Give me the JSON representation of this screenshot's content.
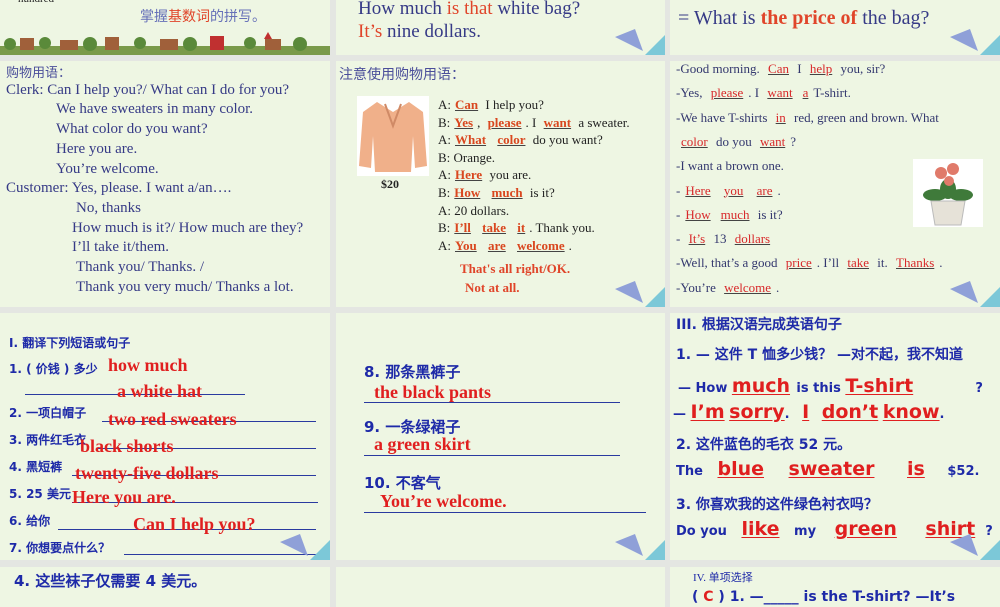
{
  "top": {
    "c1_hundred": "hundred",
    "c1_tip_a": "掌握",
    "c1_tip_b": "基数词",
    "c1_tip_c": "的拼写。",
    "c2_l1_a": "How much ",
    "c2_l1_b": "is that",
    "c2_l1_c": " white bag?",
    "c2_l2_a": "It’s",
    "c2_l2_b": " nine dollars.",
    "c3_a": "= What is ",
    "c3_b": "the price of",
    "c3_c": " the bag?"
  },
  "p1": {
    "lines": [
      "购物用语：",
      "Clerk: Can I help you?/ What can I do for you?",
      "We have sweaters in many color.",
      "What color do you want?",
      "Here you are.",
      "You’re welcome.",
      "Customer: Yes, please. I want a/an….",
      "No, thanks",
      "How much is it?/ How much are they?",
      "I’ll take it/them.",
      "Thank you/ Thanks. /",
      "Thank you very much/ Thanks a lot."
    ]
  },
  "p2": {
    "title": "注意使用购物用语：",
    "price": "$20",
    "lines": [
      [
        {
          "t": "A:"
        },
        {
          "b": "Can"
        },
        {
          "t": " I help you?"
        }
      ],
      [
        {
          "t": "B:"
        },
        {
          "b": "Yes"
        },
        {
          "t": ", "
        },
        {
          "b": "please"
        },
        {
          "t": ". I "
        },
        {
          "b": "want"
        },
        {
          "t": " a sweater."
        }
      ],
      [
        {
          "t": "A:"
        },
        {
          "b": "What"
        },
        {
          "t": " "
        },
        {
          "b": "color"
        },
        {
          "t": " do you want?"
        }
      ],
      [
        {
          "t": "B: Orange."
        }
      ],
      [
        {
          "t": "A:"
        },
        {
          "b": "Here"
        },
        {
          "t": " you are."
        }
      ],
      [
        {
          "t": "B:"
        },
        {
          "b": "How"
        },
        {
          "t": " "
        },
        {
          "b": "much"
        },
        {
          "t": " is it?"
        }
      ],
      [
        {
          "t": "A: 20 dollars."
        }
      ],
      [
        {
          "t": "B:"
        },
        {
          "b": "I’ll"
        },
        {
          "t": " "
        },
        {
          "b": "take"
        },
        {
          "t": " "
        },
        {
          "b": "it"
        },
        {
          "t": ". Thank you."
        }
      ],
      [
        {
          "t": "A:"
        },
        {
          "b": "You"
        },
        {
          "t": " "
        },
        {
          "b": "are"
        },
        {
          "t": " "
        },
        {
          "b": "welcome"
        },
        {
          "t": "."
        }
      ]
    ],
    "alt1": "That's all right/OK.",
    "alt2": "Not at all."
  },
  "p3": {
    "lines": [
      [
        {
          "t": "-Good morning. "
        },
        {
          "b": "Can"
        },
        {
          "t": " I "
        },
        {
          "b": "help"
        },
        {
          "t": " you, sir?"
        }
      ],
      [
        {
          "t": "-Yes, "
        },
        {
          "b": "please"
        },
        {
          "t": ". I "
        },
        {
          "b": "want"
        },
        {
          "b": "a"
        },
        {
          "t": "T-shirt."
        }
      ],
      [
        {
          "t": "-We have T-shirts "
        },
        {
          "b": "in"
        },
        {
          "t": " red, green and brown. What"
        }
      ],
      [
        {
          "b": "color"
        },
        {
          "t": " do you "
        },
        {
          "b": "want"
        },
        {
          "t": "?"
        }
      ],
      [
        {
          "t": "-I want a brown one."
        }
      ],
      [
        {
          "t": "-"
        },
        {
          "b": "Here"
        },
        {
          "t": " "
        },
        {
          "b": "you"
        },
        {
          "t": " "
        },
        {
          "b": "are"
        },
        {
          "t": "."
        }
      ],
      [
        {
          "t": "-"
        },
        {
          "b": "How"
        },
        {
          "b": "much"
        },
        {
          "t": " is it?"
        }
      ],
      [
        {
          "t": "- "
        },
        {
          "b": "It’s"
        },
        {
          "t": " 13 "
        },
        {
          "b": "dollars"
        }
      ],
      [
        {
          "t": "-Well, that’s a good "
        },
        {
          "b": "price"
        },
        {
          "t": ". I’ll "
        },
        {
          "b": "take"
        },
        {
          "t": " it. "
        },
        {
          "b": "Thanks"
        },
        {
          "t": "."
        }
      ],
      [
        {
          "t": "-You’re "
        },
        {
          "b": "welcome"
        },
        {
          "t": "."
        }
      ]
    ]
  },
  "p4": {
    "title": "I. 翻译下列短语或句子",
    "q": [
      "1. ( 价钱 ) 多少",
      "2. 一项白帽子",
      "3. 两件红毛衣",
      "4. 黑短裤",
      "5. 25 美元",
      "6. 给你",
      "7. 你想要点什么？"
    ],
    "a": [
      "how much",
      "a white hat",
      "two red sweaters",
      "black shorts",
      "twenty-five dollars",
      "Here you are.",
      "Can I help you?"
    ]
  },
  "p5": {
    "q8": "8.  那条黑裤子",
    "a8": "the black pants",
    "q9": "9.  一条绿裙子",
    "a9": "a green skirt",
    "q10": "10.  不客气",
    "a10": "You’re welcome."
  },
  "p6": {
    "title": "III. 根据汉语完成英语句子",
    "q1": "1. — 这件 T 恤多少钱？  —对不起，我不知道",
    "l1a": "— How",
    "a1": "much",
    "l1b": "is this",
    "a2": "T-shirt",
    "l1c": "?",
    "l2a": "—",
    "a3": "I’m",
    "a4": "sorry",
    "l2b": ".",
    "a5": "I",
    "a6": "don’t",
    "a7": "know",
    "l2c": ".",
    "q2": "2.  这件蓝色的毛衣 52 元。",
    "l3a": "The",
    "a8": "blue",
    "a9": "sweater",
    "a10": "is",
    "l3b": "$52.",
    "q3": "3.  你喜欢我的这件绿色衬衣吗？",
    "l4a": "Do you",
    "a11": "like",
    "l4b": "my",
    "a12": "green",
    "a13": "shirt",
    "l4c": "?"
  },
  "p7": {
    "text": "4.  这些袜子仅需要 4 美元。"
  },
  "p9": {
    "title": "IV. 单项选择",
    "ans": "C",
    "q": "1. —_____ is the T-shirt?  —It’s"
  }
}
